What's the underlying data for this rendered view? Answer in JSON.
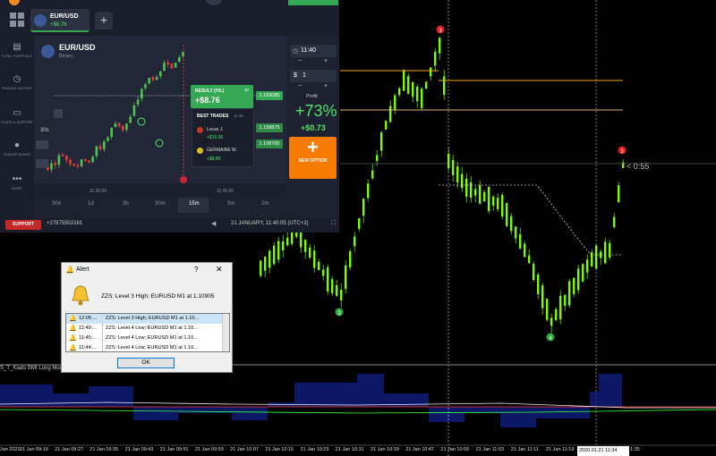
{
  "mt4": {
    "price_countdown": "< 0:55",
    "indicator_label": "S_T_Kiads BMI Long Mod",
    "time_axis": [
      "Jan 2020",
      "21 Jan 09:19",
      "21 Jan 09:27",
      "21 Jan 09:35",
      "21 Jan 09:43",
      "21 Jan 09:51",
      "21 Jan 09:59",
      "21 Jan 10:07",
      "21 Jan 10:15",
      "21 Jan 10:23",
      "21 Jan 10:31",
      "21 Jan 10:39",
      "21 Jan 10:47",
      "21 Jan 10:55",
      "21 Jan 11:03",
      "21 Jan 11:11",
      "21 Jan 11:19",
      "21 Jan 11:27"
    ],
    "time_highlight": "2020.01.21 11:34",
    "time_after": "1:35",
    "zz_markers": [
      "3",
      "3",
      "3",
      "4"
    ],
    "colors": {
      "orange_line": "#f5a623",
      "bull": "#7cfc00",
      "indicator_blue": "#1f3cff",
      "indicator_red": "#ff3b3b"
    }
  },
  "iq": {
    "tab": {
      "asset": "EUR/USD",
      "pl": "+$8.76"
    },
    "asset": {
      "name": "EUR/USD",
      "type": "Binary"
    },
    "sidebar": [
      {
        "icon": "portfolio-icon",
        "label": "TOTAL PORTFOLIO"
      },
      {
        "icon": "history-icon",
        "label": "TRADING HISTORY"
      },
      {
        "icon": "chats-icon",
        "label": "CHATS & SUPPORT"
      },
      {
        "icon": "leaderboard-icon",
        "label": "LEADER BOARD"
      },
      {
        "icon": "more-icon",
        "label": "MORE"
      }
    ],
    "chart_tools": [
      "30s"
    ],
    "result": {
      "label": "RESULT (P/L)",
      "value": "+$8.76",
      "badge": "30"
    },
    "best_trades": {
      "title": "BEST TRADES",
      "time": "11:40",
      "traders": [
        {
          "name": "Lucas J.",
          "amount": "+$16.06"
        },
        {
          "name": "GERMAINE W.",
          "amount": "+$8.80"
        }
      ]
    },
    "price_tags": [
      "1.109085",
      "1.108875",
      "1.108765"
    ],
    "time_labels": [
      "11:30:00",
      "11:45:00"
    ],
    "panel": {
      "expiry": "11:40",
      "amount_prefix": "$",
      "amount": "1",
      "profit_label": "Profit",
      "profit_pct": "+73%",
      "profit_amount": "+$0.73",
      "new_option": "NEW OPTION"
    },
    "timeframes": [
      "30d",
      "1d",
      "3h",
      "30m",
      "15m",
      "5m",
      "2m"
    ],
    "timeframe_active": "15m",
    "support": "SUPPORT",
    "phone": "+27875502161",
    "clock": "21 JANUARY, 11:40:05 (UTC+2)"
  },
  "alert": {
    "title": "Alert",
    "help": "?",
    "close": "✕",
    "message": "ZZS: Level 3 High; EURUSD  M1 at 1.10905",
    "rows": [
      {
        "time": "12:05:...",
        "msg": "ZZS: Level 3 High; EURUSD  M1 at 1.10..."
      },
      {
        "time": "11:49:...",
        "msg": "ZZS: Level 4 Low;  EURUSD  M1 at 1.10..."
      },
      {
        "time": "11:45:...",
        "msg": "ZZS: Level 4 Low;  EURUSD  M1 at 1.10..."
      },
      {
        "time": "11:44:...",
        "msg": "ZZS: Level 4 Low;  EURUSD  M1 at 1.10..."
      }
    ],
    "ok": "OK"
  }
}
